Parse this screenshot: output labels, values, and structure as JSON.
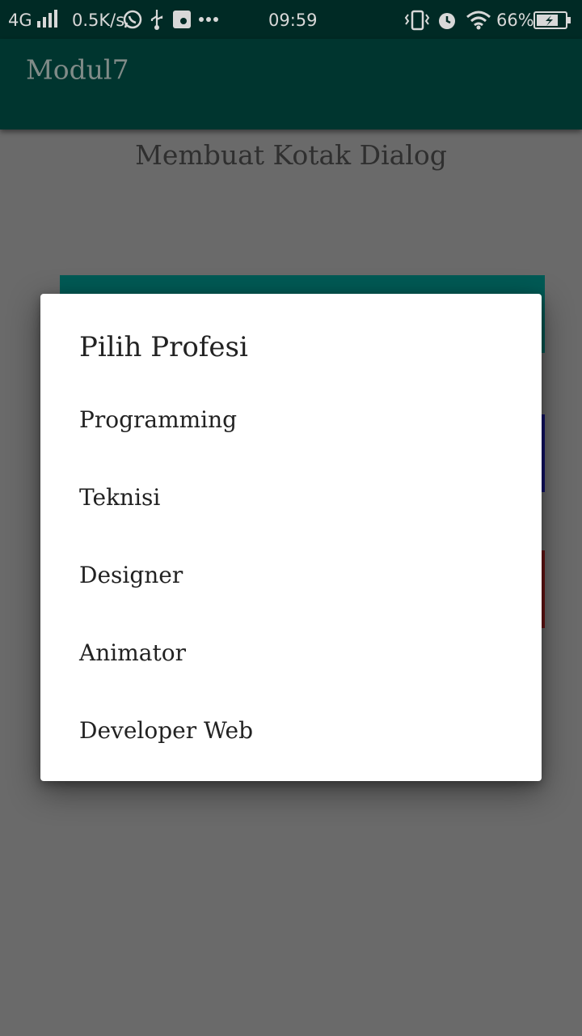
{
  "status_bar": {
    "network": "4G",
    "speed": "0.5K/s",
    "time": "09:59",
    "battery": "66%",
    "icons": [
      "signal-icon",
      "whatsapp-icon",
      "usb-icon",
      "notification-icon",
      "more-icon",
      "vibrate-icon",
      "alarm-icon",
      "wifi-icon",
      "battery-icon"
    ]
  },
  "app_bar": {
    "title": "Modul7"
  },
  "content": {
    "heading": "Membuat Kotak Dialog"
  },
  "colors": {
    "status_bar": "#002a25",
    "app_bar": "#00352f",
    "scrim": "#6a6a6a",
    "teal_button": "#005a55",
    "blue_button": "#13136c",
    "red_button": "#6a1414"
  },
  "dialog": {
    "title": "Pilih Profesi",
    "items": [
      {
        "label": "Programming"
      },
      {
        "label": "Teknisi"
      },
      {
        "label": "Designer"
      },
      {
        "label": "Animator"
      },
      {
        "label": "Developer Web"
      }
    ]
  }
}
